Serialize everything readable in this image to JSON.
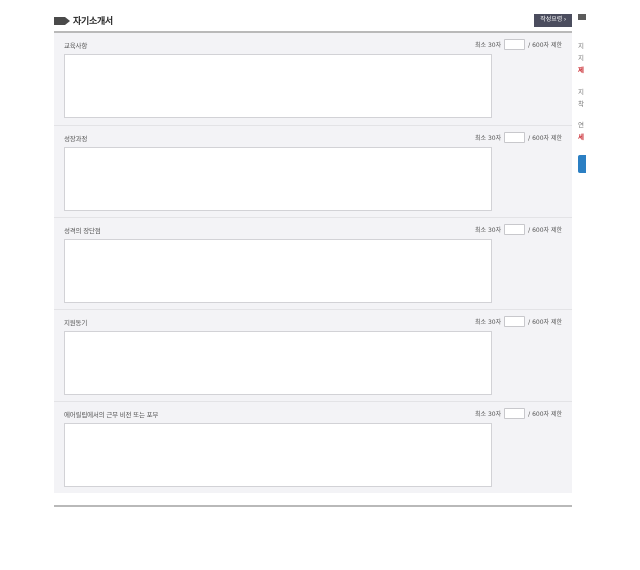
{
  "header": {
    "title": "자기소개서",
    "guide_button": "작성요령 ›"
  },
  "sections": [
    {
      "label": "교육사항",
      "min_text": "최소 30자",
      "limit_text": "/ 600자 제한",
      "value": ""
    },
    {
      "label": "성장과정",
      "min_text": "최소 30자",
      "limit_text": "/ 600자 제한",
      "value": ""
    },
    {
      "label": "성격의 장단점",
      "min_text": "최소 30자",
      "limit_text": "/ 600자 제한",
      "value": ""
    },
    {
      "label": "지원동기",
      "min_text": "최소 30자",
      "limit_text": "/ 600자 제한",
      "value": ""
    },
    {
      "label": "에어릴립에서의 근무 비전 또는 포부",
      "min_text": "최소 30자",
      "limit_text": "/ 600자 제한",
      "value": ""
    }
  ],
  "side_panel": {
    "lines": [
      "지",
      "지",
      "제",
      "지",
      "착",
      "연",
      "세"
    ],
    "highlight_color": "#c8262d",
    "button_color": "#2b7fc3"
  }
}
